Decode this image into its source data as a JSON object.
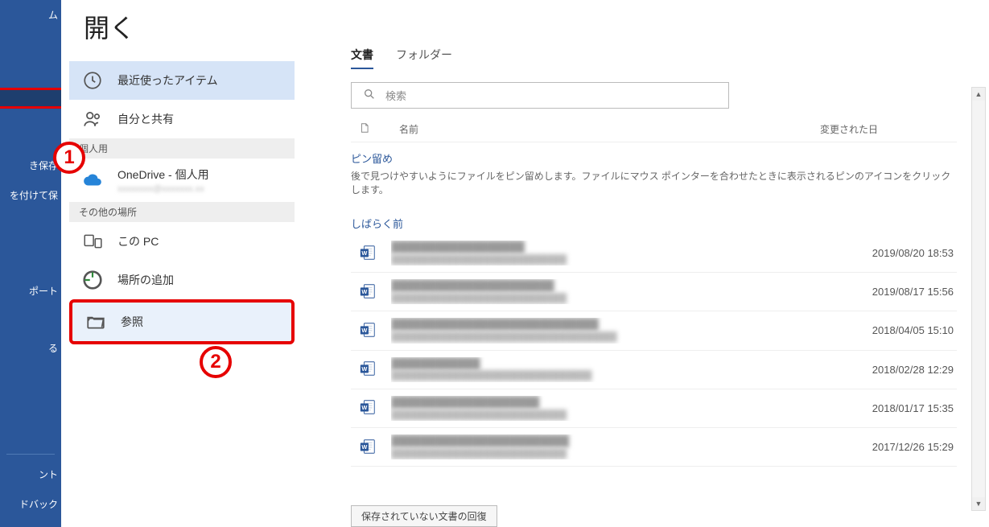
{
  "page_title": "開く",
  "navrail": {
    "items": [
      {
        "label": "ム"
      },
      {
        "label": ""
      },
      {
        "label": "き保存"
      },
      {
        "label": "を付けて保"
      },
      {
        "label": "ポート"
      },
      {
        "label": "る"
      },
      {
        "label": "ント"
      },
      {
        "label": "ドバック"
      }
    ]
  },
  "locations": {
    "recent": "最近使ったアイテム",
    "shared": "自分と共有",
    "group_personal": "個人用",
    "onedrive": "OneDrive - 個人用",
    "onedrive_sub": "xxxxxxxx@xxxxxxx.xx",
    "group_other": "その他の場所",
    "this_pc": "この PC",
    "add_place": "場所の追加",
    "browse": "参照"
  },
  "tabs": {
    "documents": "文書",
    "folders": "フォルダー"
  },
  "search": {
    "placeholder": "検索"
  },
  "columns": {
    "name": "名前",
    "modified": "変更された日"
  },
  "pinned": {
    "label": "ピン留め",
    "desc": "後で見つけやすいようにファイルをピン留めします。ファイルにマウス ポインターを合わせたときに表示されるピンのアイコンをクリックします。"
  },
  "recent_section": {
    "label": "しばらく前"
  },
  "files": [
    {
      "name": "██████████████████",
      "path": "████████████████████████████",
      "date": "2019/08/20 18:53"
    },
    {
      "name": "██████████████████████",
      "path": "████████████████████████████",
      "date": "2019/08/17 15:56"
    },
    {
      "name": "████████████████████████████",
      "path": "████████████████████████████████████",
      "date": "2018/04/05 15:10"
    },
    {
      "name": "████████████",
      "path": "████████████████████████████████",
      "date": "2018/02/28 12:29"
    },
    {
      "name": "████████████████████",
      "path": "████████████████████████████",
      "date": "2018/01/17 15:35"
    },
    {
      "name": "████████████████████████",
      "path": "████████████████████████████",
      "date": "2017/12/26 15:29"
    }
  ],
  "recover_button": "保存されていない文書の回復",
  "annotations": {
    "one": "1",
    "two": "2"
  }
}
